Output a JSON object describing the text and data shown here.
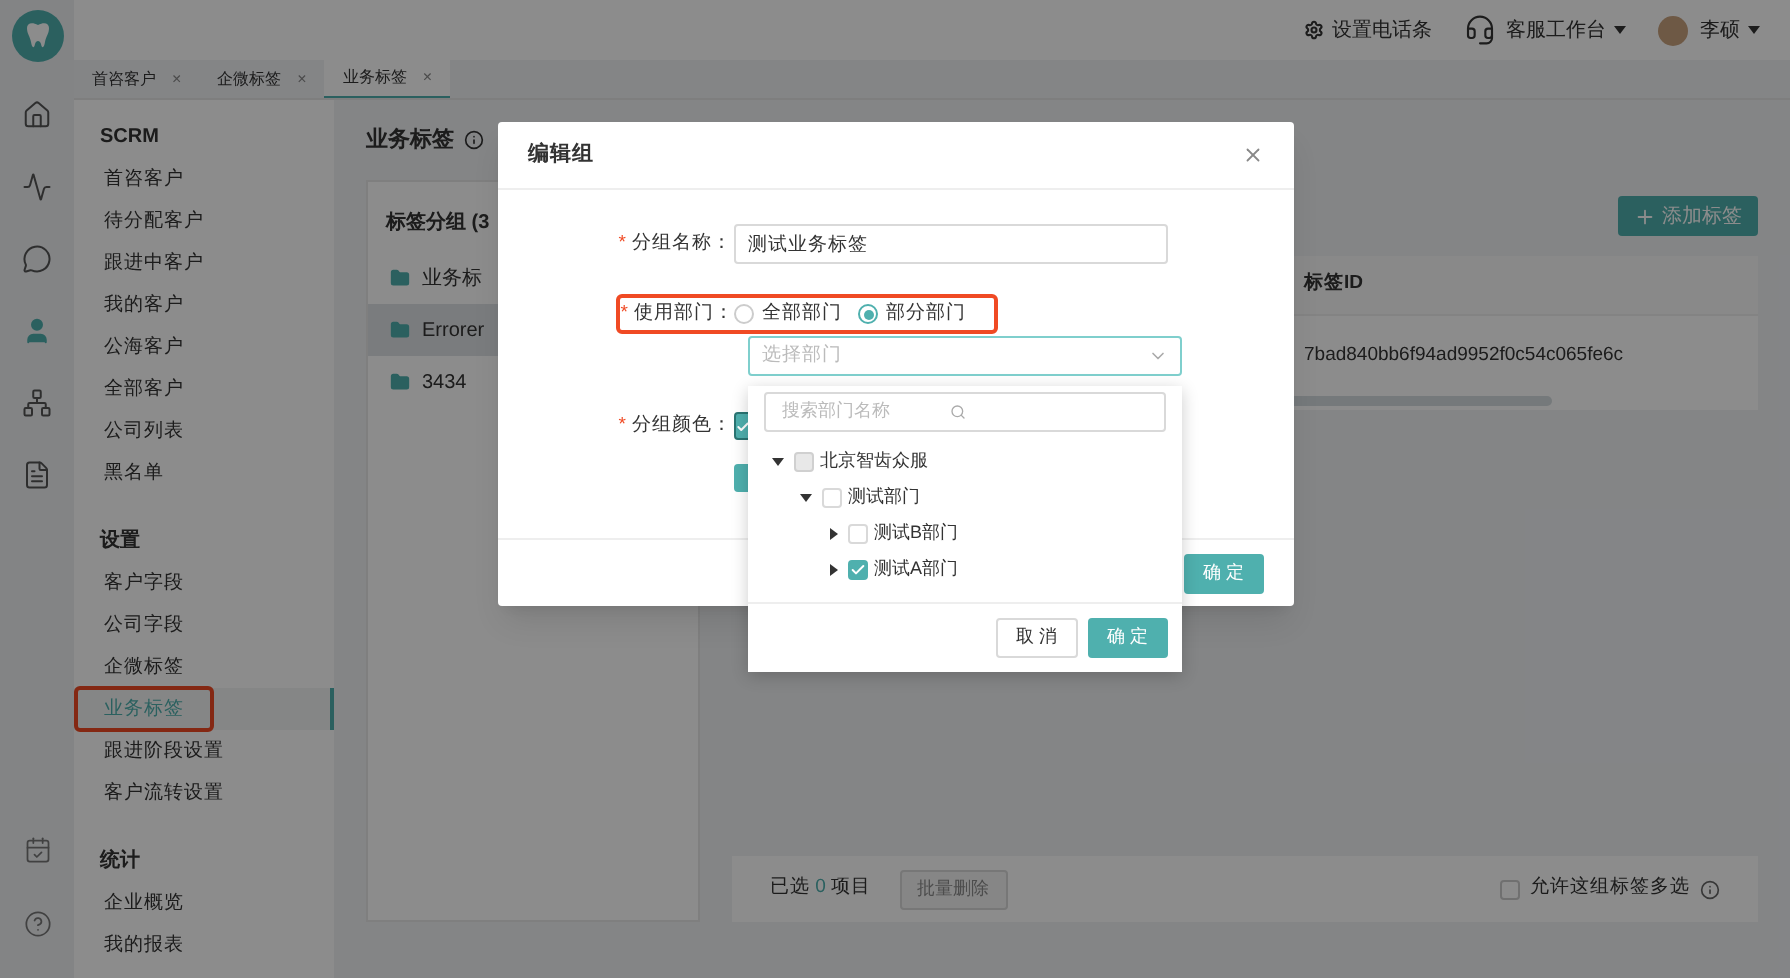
{
  "topbar": {
    "phone_setting": "设置电话条",
    "workbench": "客服工作台",
    "user": "李硕"
  },
  "rail": [
    {
      "kind": "home",
      "selected": false
    },
    {
      "kind": "chart",
      "selected": false
    },
    {
      "kind": "chat",
      "selected": false
    },
    {
      "kind": "user",
      "selected": true
    },
    {
      "kind": "org",
      "selected": false
    },
    {
      "kind": "doc",
      "selected": false
    },
    {
      "kind": "calendar",
      "selected": false
    },
    {
      "kind": "help",
      "selected": false
    }
  ],
  "tabs": [
    {
      "label": "首咨客户",
      "close": "×",
      "selected": false
    },
    {
      "label": "企微标签",
      "close": "×",
      "selected": false
    },
    {
      "label": "业务标签",
      "close": "×",
      "selected": true
    }
  ],
  "sidebar": {
    "sections": [
      {
        "title": "SCRM",
        "items": [
          {
            "label": "首咨客户",
            "selected": false,
            "annotated": false
          },
          {
            "label": "待分配客户",
            "selected": false,
            "annotated": false
          },
          {
            "label": "跟进中客户",
            "selected": false,
            "annotated": false
          },
          {
            "label": "我的客户",
            "selected": false,
            "annotated": false
          },
          {
            "label": "公海客户",
            "selected": false,
            "annotated": false
          },
          {
            "label": "全部客户",
            "selected": false,
            "annotated": false
          },
          {
            "label": "公司列表",
            "selected": false,
            "annotated": false
          },
          {
            "label": "黑名单",
            "selected": false,
            "annotated": false
          }
        ]
      },
      {
        "title": "设置",
        "items": [
          {
            "label": "客户字段",
            "selected": false,
            "annotated": false
          },
          {
            "label": "公司字段",
            "selected": false,
            "annotated": false
          },
          {
            "label": "企微标签",
            "selected": false,
            "annotated": false
          },
          {
            "label": "业务标签",
            "selected": true,
            "annotated": true
          },
          {
            "label": "跟进阶段设置",
            "selected": false,
            "annotated": false
          },
          {
            "label": "客户流转设置",
            "selected": false,
            "annotated": false
          }
        ]
      },
      {
        "title": "统计",
        "items": [
          {
            "label": "企业概览",
            "selected": false,
            "annotated": false
          },
          {
            "label": "我的报表",
            "selected": false,
            "annotated": false
          }
        ]
      }
    ]
  },
  "page_title": "业务标签",
  "groups_panel": {
    "title": "标签分组 (3",
    "groups": [
      {
        "name": "业务标",
        "selected": false
      },
      {
        "name": "Errorer",
        "selected": true
      },
      {
        "name": "3434",
        "selected": false
      }
    ]
  },
  "add_button": "添加标签",
  "table": {
    "columns": [
      "标签ID"
    ],
    "rows": [
      [
        "7bad840bb6f94ad9952f0c54c065fe6c"
      ]
    ]
  },
  "footer": {
    "selected_prefix": "已选",
    "selected_count": "0",
    "selected_suffix": "项目",
    "batch_delete": {
      "label": "批量删除",
      "disabled": true
    },
    "multi_select": {
      "label": "允许这组标签多选",
      "checked": false
    }
  },
  "modal": {
    "title": "编辑组",
    "name_field": {
      "required_mark": "*",
      "label": "分组名称：",
      "value": "测试业务标签"
    },
    "dept_field": {
      "required_mark": "*",
      "label": "使用部门：",
      "annotated": true,
      "options": [
        {
          "label": "全部部门",
          "selected": false
        },
        {
          "label": "部分部门",
          "selected": true
        }
      ]
    },
    "dept_select": {
      "placeholder": "选择部门",
      "open": true
    },
    "color_field": {
      "required_mark": "*",
      "label": "分组颜色：",
      "swatches": [
        {
          "color": "#4fb0ae",
          "selected": true
        },
        {
          "color": "#4fb0ae",
          "selected": false
        }
      ]
    },
    "ok_button": "确 定"
  },
  "dept_dropdown": {
    "search_placeholder": "搜索部门名称",
    "tree": [
      {
        "label": "北京智齿众服",
        "expanded": true,
        "checked": false,
        "disabled": true,
        "children": [
          {
            "label": "测试部门",
            "expanded": true,
            "checked": false,
            "disabled": false,
            "children": [
              {
                "label": "测试B部门",
                "expanded": false,
                "checked": false,
                "disabled": false
              },
              {
                "label": "测试A部门",
                "expanded": false,
                "checked": true,
                "disabled": false
              }
            ]
          }
        ]
      }
    ],
    "cancel_button": "取 消",
    "ok_button": "确 定"
  }
}
